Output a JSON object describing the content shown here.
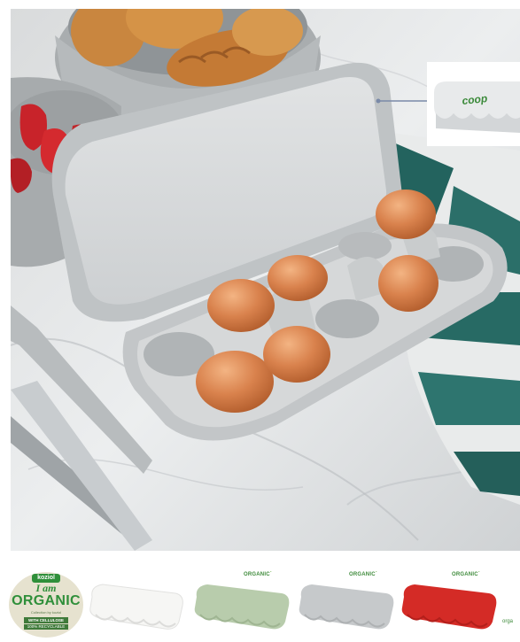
{
  "hero": {
    "tray_logo": "coop"
  },
  "badge": {
    "brand": "koziol",
    "line1": "I am",
    "line2": "ORGANIC",
    "line3": "Collection by koziol",
    "line4": "WITH CELLULOSE",
    "line5": "100% RECYCLABLE"
  },
  "variants": [
    {
      "name": "white",
      "color": "#f4f4f2",
      "label": ""
    },
    {
      "name": "green",
      "color": "#b8ccac",
      "label": "ORGANIC"
    },
    {
      "name": "grey",
      "color": "#c6c9cb",
      "label": "ORGANIC"
    },
    {
      "name": "red",
      "color": "#d42b26",
      "label": "ORGANIC"
    }
  ],
  "tail_text": "orga"
}
